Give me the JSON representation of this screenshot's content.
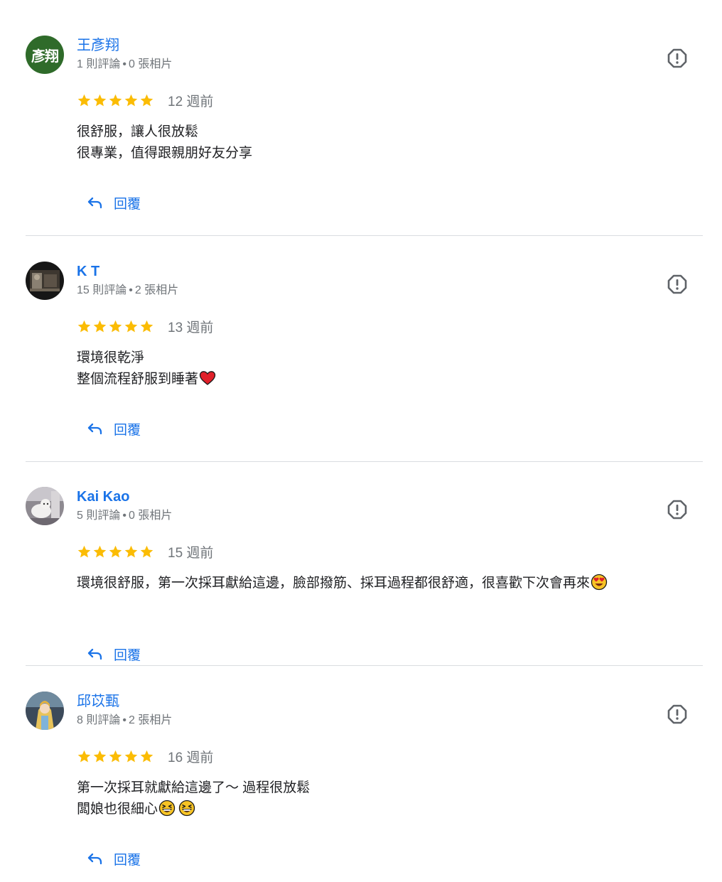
{
  "colors": {
    "accent": "#1a73e8",
    "star": "#fbbc04",
    "meta_text": "#70757a",
    "divider": "#dadce0",
    "avatar_initials_bg": "#2f6b2a"
  },
  "reviews": [
    {
      "author": "王彥翔",
      "avatar_text": "彥翔",
      "review_count": "1 則評論",
      "photo_count": "0 張相片",
      "rating": 5,
      "time": "12 週前",
      "text_lines": [
        "很舒服，讓人很放鬆",
        "很專業，值得跟親朋好友分享"
      ],
      "reply_label": "回覆"
    },
    {
      "author": "K T",
      "review_count": "15 則評論",
      "photo_count": "2 張相片",
      "rating": 5,
      "time": "13 週前",
      "text_lines": [
        "環境很乾淨",
        "整個流程舒服到睡著"
      ],
      "reply_label": "回覆"
    },
    {
      "author": "Kai Kao",
      "review_count": "5 則評論",
      "photo_count": "0 張相片",
      "rating": 5,
      "time": "15 週前",
      "text_lines": [
        "環境很舒服，第一次採耳獻給這邊，臉部撥筋、採耳過程都很舒適，很喜歡下次會再來"
      ],
      "reply_label": "回覆"
    },
    {
      "author": "邱苡甄",
      "review_count": "8 則評論",
      "photo_count": "2 張相片",
      "rating": 5,
      "time": "16 週前",
      "text_lines": [
        "第一次採耳就獻給這邊了～ 過程很放鬆",
        "闆娘也很細心"
      ],
      "reply_label": "回覆"
    }
  ]
}
